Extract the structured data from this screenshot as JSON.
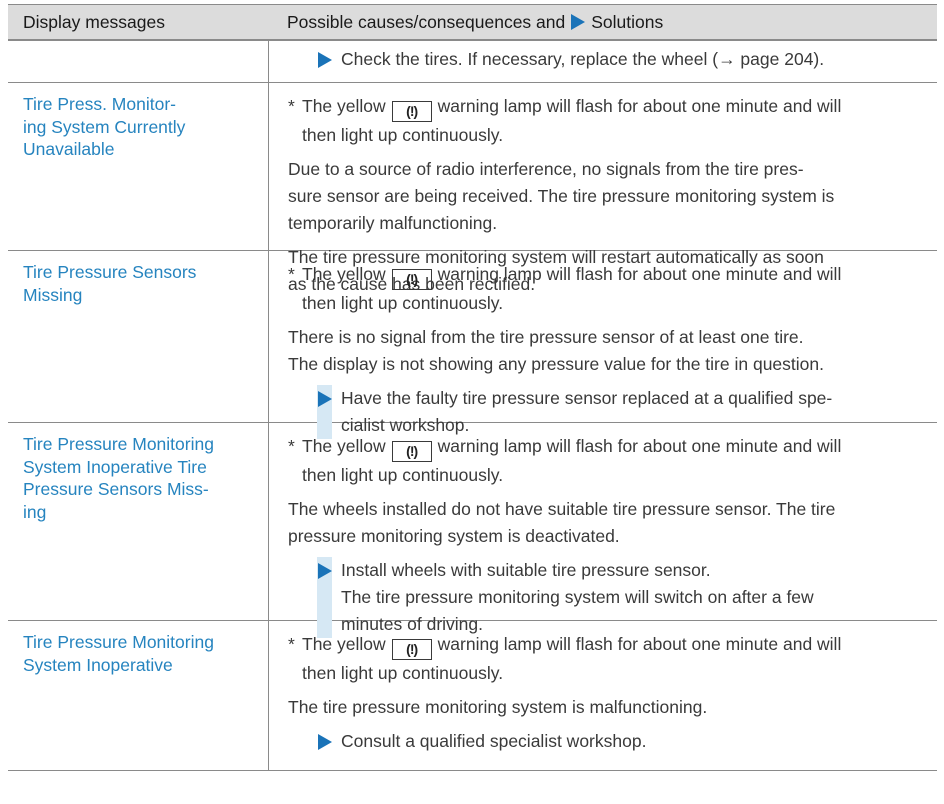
{
  "header": {
    "col1": "Display messages",
    "col2_prefix": "Possible causes/consequences and",
    "col2_suffix": "Solutions"
  },
  "lamp_symbol": "(!)",
  "row0": {
    "solution": "Check the tires. If necessary, replace the wheel (→ page 204)."
  },
  "row1": {
    "message_lines": [
      "Tire Press. Monitor-",
      "ing System Currently",
      "Unavailable"
    ],
    "star_mark": "*",
    "star_pre": "The yellow",
    "star_post_1": "warning lamp will flash for about one minute and will",
    "star_post_2": "then light up continuously.",
    "p1": [
      "Due to a source of radio interference, no signals from the tire pres-",
      "sure sensor are being received. The tire pressure monitoring system is",
      "temporarily malfunctioning."
    ],
    "p2": [
      "The tire pressure monitoring system will restart automatically as soon",
      "as the cause has been rectified."
    ]
  },
  "row2": {
    "message_lines": [
      "Tire Pressure Sensors",
      "Missing"
    ],
    "star_mark": "*",
    "star_pre": "The yellow",
    "star_post_1": "warning lamp will flash for about one minute and will",
    "star_post_2": "then light up continuously.",
    "p1": [
      "There is no signal from the tire pressure sensor of at least one tire.",
      "The display is not showing any pressure value for the tire in question."
    ],
    "solution": [
      "Have the faulty tire pressure sensor replaced at a qualified spe-",
      "cialist workshop."
    ]
  },
  "row3": {
    "message_lines": [
      "Tire Pressure Monitoring",
      "System Inoperative Tire",
      "Pressure Sensors Miss-",
      "ing"
    ],
    "star_mark": "*",
    "star_pre": "The yellow",
    "star_post_1": "warning lamp will flash for about one minute and will",
    "star_post_2": "then light up continuously.",
    "p1": [
      "The wheels installed do not have suitable tire pressure sensor. The tire",
      "pressure monitoring system is deactivated."
    ],
    "solution": [
      "Install wheels with suitable tire pressure sensor.",
      "The tire pressure monitoring system will switch on after a few",
      "minutes of driving."
    ]
  },
  "row4": {
    "message_lines": [
      "Tire Pressure Monitoring",
      "System Inoperative"
    ],
    "star_mark": "*",
    "star_pre": "The yellow",
    "star_post_1": "warning lamp will flash for about one minute and will",
    "star_post_2": "then light up continuously.",
    "p1": [
      "The tire pressure monitoring system is malfunctioning."
    ],
    "solution": [
      "Consult a qualified specialist workshop."
    ]
  },
  "colors": {
    "accent": "#2684bf",
    "triangle": "#1a73b8",
    "solution_bar": "#d6e8f4",
    "header_bg": "#dcdcdc"
  }
}
